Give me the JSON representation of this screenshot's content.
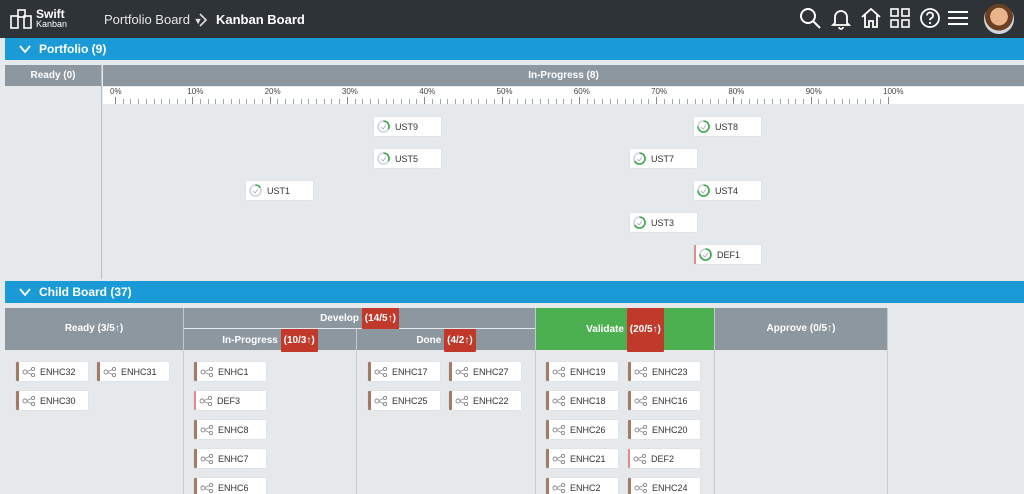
{
  "app": {
    "logo_line1": "Swift",
    "logo_line2": "Kanban",
    "breadcrumb_parent": "Portfolio Board",
    "breadcrumb_current": "Kanban Board"
  },
  "colors": {
    "nav_bg": "#2e3338",
    "section_blue": "#1a9ad6",
    "lane_gray": "#8c979f",
    "validate_green": "#4caf50",
    "limit_badge_red": "#c0392b"
  },
  "icons": [
    "search-icon",
    "bell-icon",
    "home-icon",
    "grid-icon",
    "help-icon",
    "menu-icon"
  ],
  "portfolio": {
    "title": "Portfolio (9)",
    "ready_label": "Ready (0)",
    "inprogress_label": "In-Progress (8)",
    "ruler_labels": [
      "0%",
      "10%",
      "20%",
      "30%",
      "40%",
      "50%",
      "60%",
      "70%",
      "80%",
      "90%",
      "100%"
    ],
    "cards": [
      {
        "id": "UST9",
        "progress": 33
      },
      {
        "id": "UST8",
        "progress": 75
      },
      {
        "id": "UST5",
        "progress": 33
      },
      {
        "id": "UST7",
        "progress": 67
      },
      {
        "id": "UST1",
        "progress": 17
      },
      {
        "id": "UST4",
        "progress": 75
      },
      {
        "id": "UST3",
        "progress": 67
      },
      {
        "id": "DEF1",
        "progress": 75
      }
    ]
  },
  "child_board": {
    "title": "Child Board (37)",
    "ready": {
      "label": "Ready (3/5",
      "arrow": "↑)"
    },
    "develop": {
      "label": "Develop",
      "badge": "(14/5↑)"
    },
    "inprogress": {
      "label": "In-Progress",
      "badge": "(10/3↑)"
    },
    "done": {
      "label": "Done",
      "badge": "(4/2↑)"
    },
    "validate": {
      "label": "Validate",
      "badge": "(20/5↑)"
    },
    "approve": {
      "label": "Approve (0/5",
      "arrow": "↑)"
    },
    "ready_cards": [
      "ENHC32",
      "ENHC31",
      "ENHC30"
    ],
    "inprogress_cards": [
      "ENHC1",
      "DEF3",
      "ENHC8",
      "ENHC7",
      "ENHC6"
    ],
    "done_cards": [
      "ENHC17",
      "ENHC27",
      "ENHC25",
      "ENHC22"
    ],
    "validate_cards": [
      "ENHC19",
      "ENHC23",
      "ENHC18",
      "ENHC16",
      "ENHC26",
      "ENHC20",
      "ENHC21",
      "DEF2",
      "ENHC2",
      "ENHC24"
    ]
  }
}
